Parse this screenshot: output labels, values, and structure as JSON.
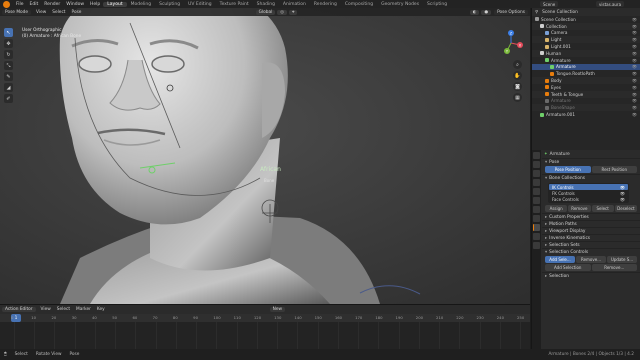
{
  "topbar": {
    "menus": [
      "File",
      "Edit",
      "Render",
      "Window",
      "Help"
    ],
    "workspaces": [
      "Layout",
      "Modeling",
      "Sculpting",
      "UV Editing",
      "Texture Paint",
      "Shading",
      "Animation",
      "Rendering",
      "Compositing",
      "Geometry Nodes",
      "Scripting"
    ],
    "active_workspace": "Layout",
    "scene": "Scene",
    "view_layer": "ViewLayer",
    "file_name": "vistas.aura"
  },
  "viewport": {
    "mode": "Pose Mode",
    "menus": [
      "View",
      "Select",
      "Pose"
    ],
    "orientation": "Global",
    "pose_options": "Pose Options",
    "view_name": "User Orthographic",
    "object_info": "(0) Armature : African Bone",
    "bone_label": "African",
    "bone_sublabel": "Bone",
    "gizmo_axes": {
      "x": "X",
      "y": "Y",
      "z": "Z"
    },
    "colors": {
      "x_axis": "#e44c5b",
      "y_axis": "#7ab83a",
      "z_axis": "#3b7fe8",
      "bone": "#6fcf6a"
    }
  },
  "tools": [
    "↖",
    "✥",
    "↻",
    "⤡",
    "✎",
    "◢",
    "✐"
  ],
  "timeline": {
    "editor": "Action Editor",
    "menus": [
      "View",
      "Select",
      "Marker",
      "Key"
    ],
    "new_label": "New",
    "current_frame": 1,
    "ticks": [
      0,
      10,
      20,
      30,
      40,
      50,
      60,
      70,
      80,
      90,
      100,
      110,
      120,
      130,
      140,
      150,
      160,
      170,
      180,
      190,
      200,
      210,
      220,
      230,
      240,
      250
    ]
  },
  "statusbar": {
    "items": [
      "Select",
      "Rotate View",
      "Pose"
    ],
    "version": "Armature | Bones 2/4 | Objects 1/3 | 4.2"
  },
  "outliner": {
    "title": "Scene Collection",
    "rows": [
      {
        "label": "Scene Collection",
        "indent": 0,
        "color": "#9a9a9a",
        "state": ""
      },
      {
        "label": "Collection",
        "indent": 1,
        "color": "#cfcfcf",
        "state": ""
      },
      {
        "label": "Camera",
        "indent": 2,
        "color": "#7aa0d8",
        "state": ""
      },
      {
        "label": "Light",
        "indent": 2,
        "color": "#d8b46a",
        "state": ""
      },
      {
        "label": "Light.001",
        "indent": 2,
        "color": "#d8b46a",
        "state": ""
      },
      {
        "label": "Human",
        "indent": 1,
        "color": "#cfcfcf",
        "state": ""
      },
      {
        "label": "Armature",
        "indent": 2,
        "color": "#6fcf6a",
        "state": ""
      },
      {
        "label": "Armature",
        "indent": 3,
        "color": "#6fcf6a",
        "state": "sel"
      },
      {
        "label": "Tongue.RootIoPath",
        "indent": 3,
        "color": "#e87d0d",
        "state": ""
      },
      {
        "label": "Body",
        "indent": 2,
        "color": "#e87d0d",
        "state": ""
      },
      {
        "label": "Eyes",
        "indent": 2,
        "color": "#e87d0d",
        "state": ""
      },
      {
        "label": "Teeth & Tongue",
        "indent": 2,
        "color": "#e87d0d",
        "state": ""
      },
      {
        "label": "Armature",
        "indent": 2,
        "color": "#6a6a6a",
        "state": "dim"
      },
      {
        "label": "BoneShape",
        "indent": 2,
        "color": "#6a6a6a",
        "state": "dim"
      },
      {
        "label": "Armature.001",
        "indent": 1,
        "color": "#6fcf6a",
        "state": ""
      }
    ]
  },
  "properties": {
    "object_name": "Armature",
    "pose_section": "Pose",
    "pose_position": "Pose Position",
    "rest_position": "Rest Position",
    "bone_collections": "Bone Collections",
    "collections": [
      "IK Controls",
      "FK Controls",
      "Face Controls"
    ],
    "collection_buttons": [
      "Assign",
      "Remove",
      "Select",
      "Deselect"
    ],
    "sections": [
      "Custom Properties",
      "Motion Paths",
      "Viewport Display",
      "Inverse Kinematics",
      "Selection Sets",
      "Selection Controls"
    ],
    "set_buttons": [
      "Add Sele...",
      "Remove...",
      "Update S..."
    ],
    "bottom_buttons": [
      "Add Selection",
      "Remove..."
    ],
    "last_section": "Selection"
  }
}
